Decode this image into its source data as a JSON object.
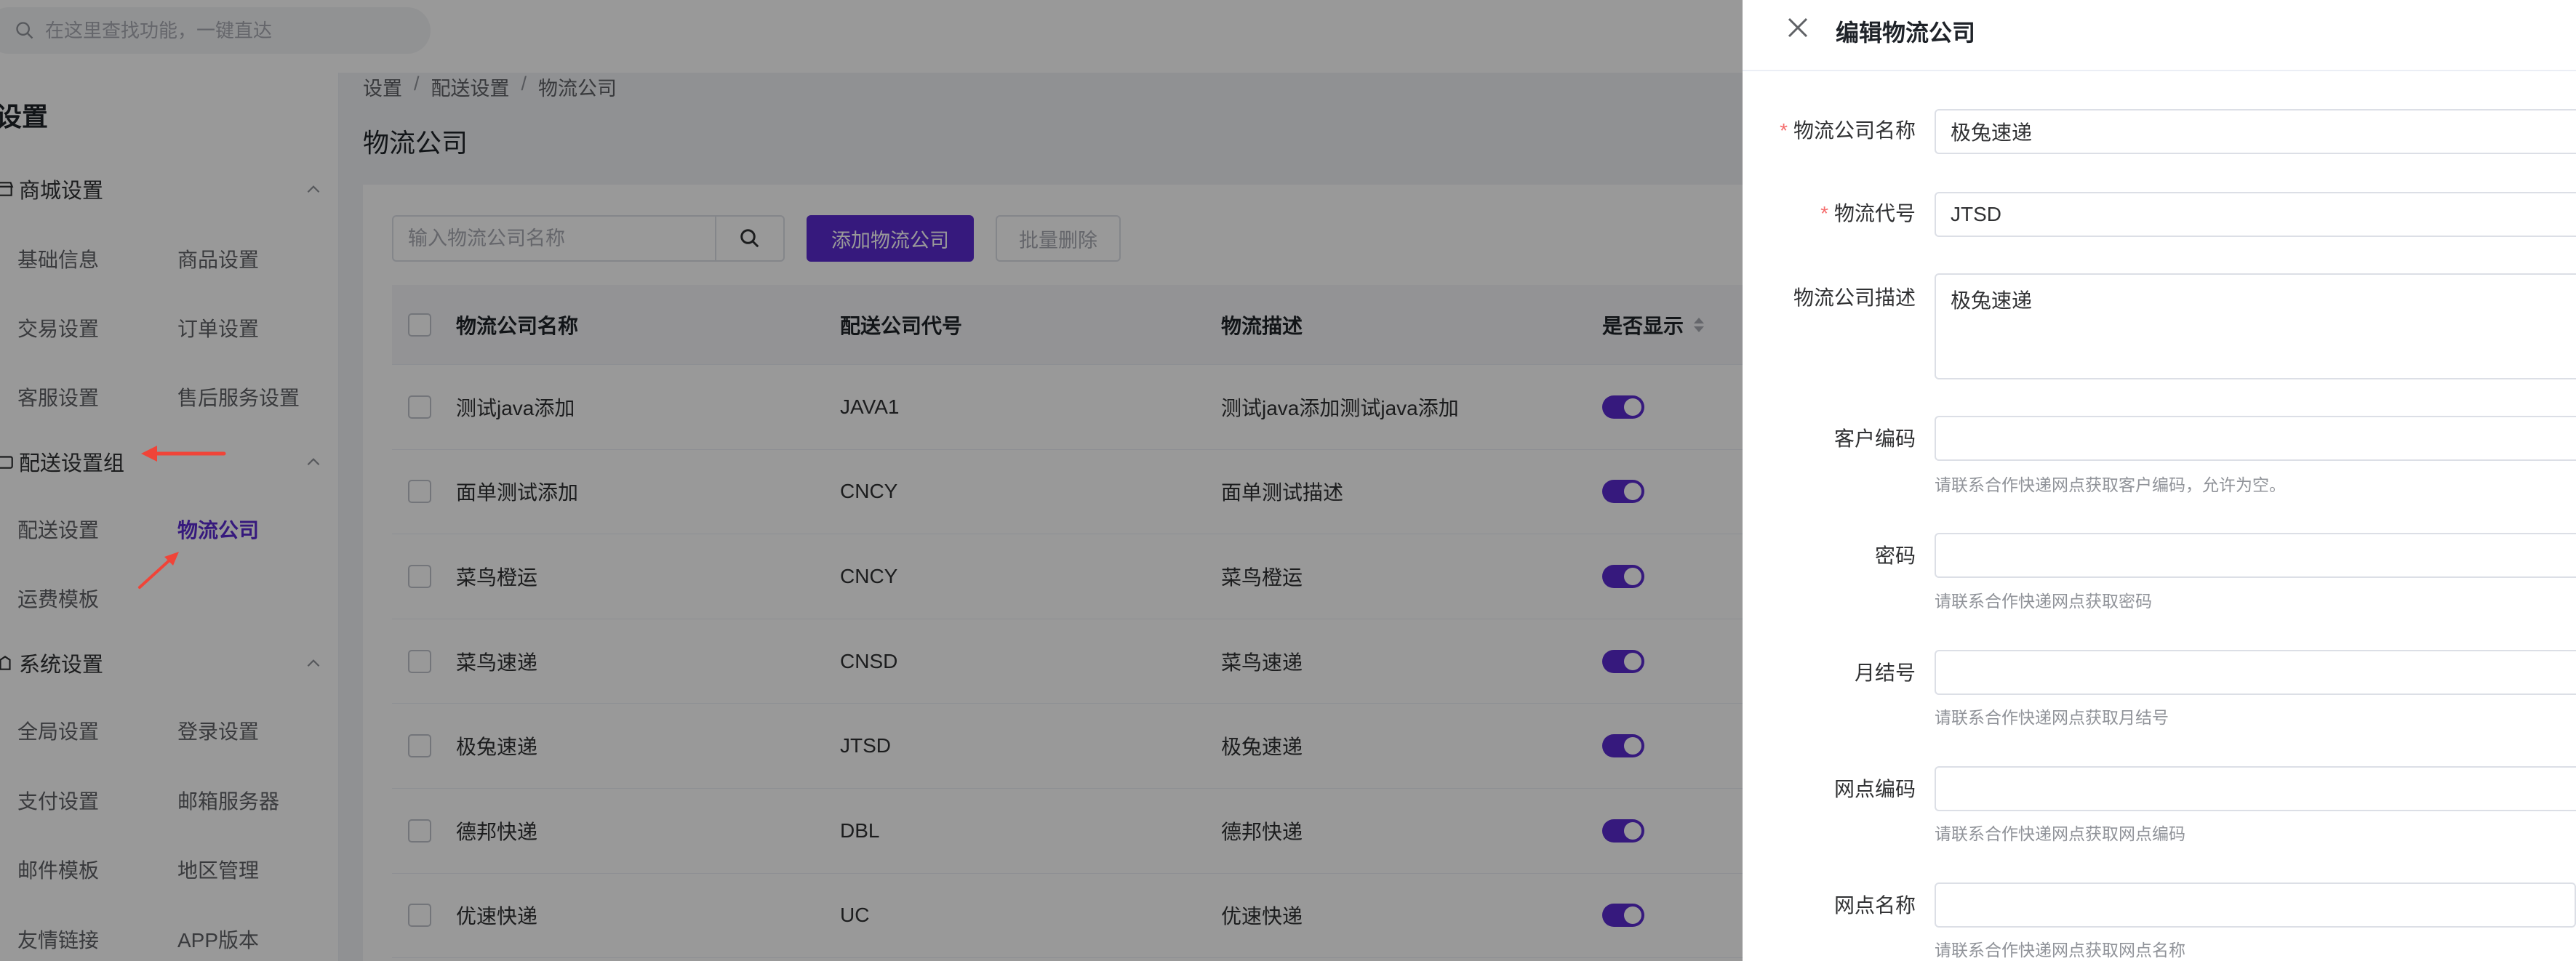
{
  "search": {
    "placeholder": "在这里查找功能，一键直达"
  },
  "sidebar": {
    "title": "设置",
    "groups": [
      {
        "name": "商城设置",
        "icon": "shop-icon",
        "items": [
          "基础信息",
          "商品设置",
          "交易设置",
          "订单设置",
          "客服设置",
          "售后服务设置"
        ]
      },
      {
        "name": "配送设置组",
        "icon": "truck-icon",
        "items": [
          "配送设置",
          "物流公司",
          "运费模板"
        ]
      },
      {
        "name": "系统设置",
        "icon": "system-icon",
        "items": [
          "全局设置",
          "登录设置",
          "支付设置",
          "邮箱服务器",
          "邮件模板",
          "地区管理",
          "友情链接",
          "APP版本"
        ]
      }
    ],
    "active_item": "物流公司"
  },
  "breadcrumb": [
    "设置",
    "配送设置",
    "物流公司"
  ],
  "page_title": "物流公司",
  "toolbar": {
    "search_placeholder": "输入物流公司名称",
    "add_label": "添加物流公司",
    "batch_delete_label": "批量删除"
  },
  "table": {
    "columns": [
      "物流公司名称",
      "配送公司代号",
      "物流描述",
      "是否显示"
    ],
    "rows": [
      {
        "name": "测试java添加",
        "code": "JAVA1",
        "desc": "测试java添加测试java添加",
        "show": true
      },
      {
        "name": "面单测试添加",
        "code": "CNCY",
        "desc": "面单测试描述",
        "show": true
      },
      {
        "name": "菜鸟橙运",
        "code": "CNCY",
        "desc": "菜鸟橙运",
        "show": true
      },
      {
        "name": "菜鸟速递",
        "code": "CNSD",
        "desc": "菜鸟速递",
        "show": true
      },
      {
        "name": "极兔速递",
        "code": "JTSD",
        "desc": "极兔速递",
        "show": true
      },
      {
        "name": "德邦快递",
        "code": "DBL",
        "desc": "德邦快递",
        "show": true
      },
      {
        "name": "优速快递",
        "code": "UC",
        "desc": "优速快递",
        "show": true
      }
    ]
  },
  "drawer": {
    "title": "编辑物流公司",
    "fields": {
      "name": {
        "label": "物流公司名称",
        "value": "极兔速递",
        "required": "*"
      },
      "code": {
        "label": "物流代号",
        "value": "JTSD",
        "required": "*"
      },
      "desc": {
        "label": "物流公司描述",
        "value": "极兔速递"
      },
      "customer_code": {
        "label": "客户编码",
        "value": "",
        "hint": "请联系合作快递网点获取客户编码，允许为空。"
      },
      "password": {
        "label": "密码",
        "value": "",
        "hint": "请联系合作快递网点获取密码"
      },
      "month_code": {
        "label": "月结号",
        "value": "",
        "hint": "请联系合作快递网点获取月结号"
      },
      "site_code": {
        "label": "网点编码",
        "value": "",
        "hint": "请联系合作快递网点获取网点编码"
      },
      "site_name": {
        "label": "网点名称",
        "value": "",
        "hint": "请联系合作快递网点获取网点名称"
      }
    }
  },
  "colors": {
    "primary": "#5b2bd1",
    "annotation": "#f04438",
    "required": "#f56c6c"
  }
}
